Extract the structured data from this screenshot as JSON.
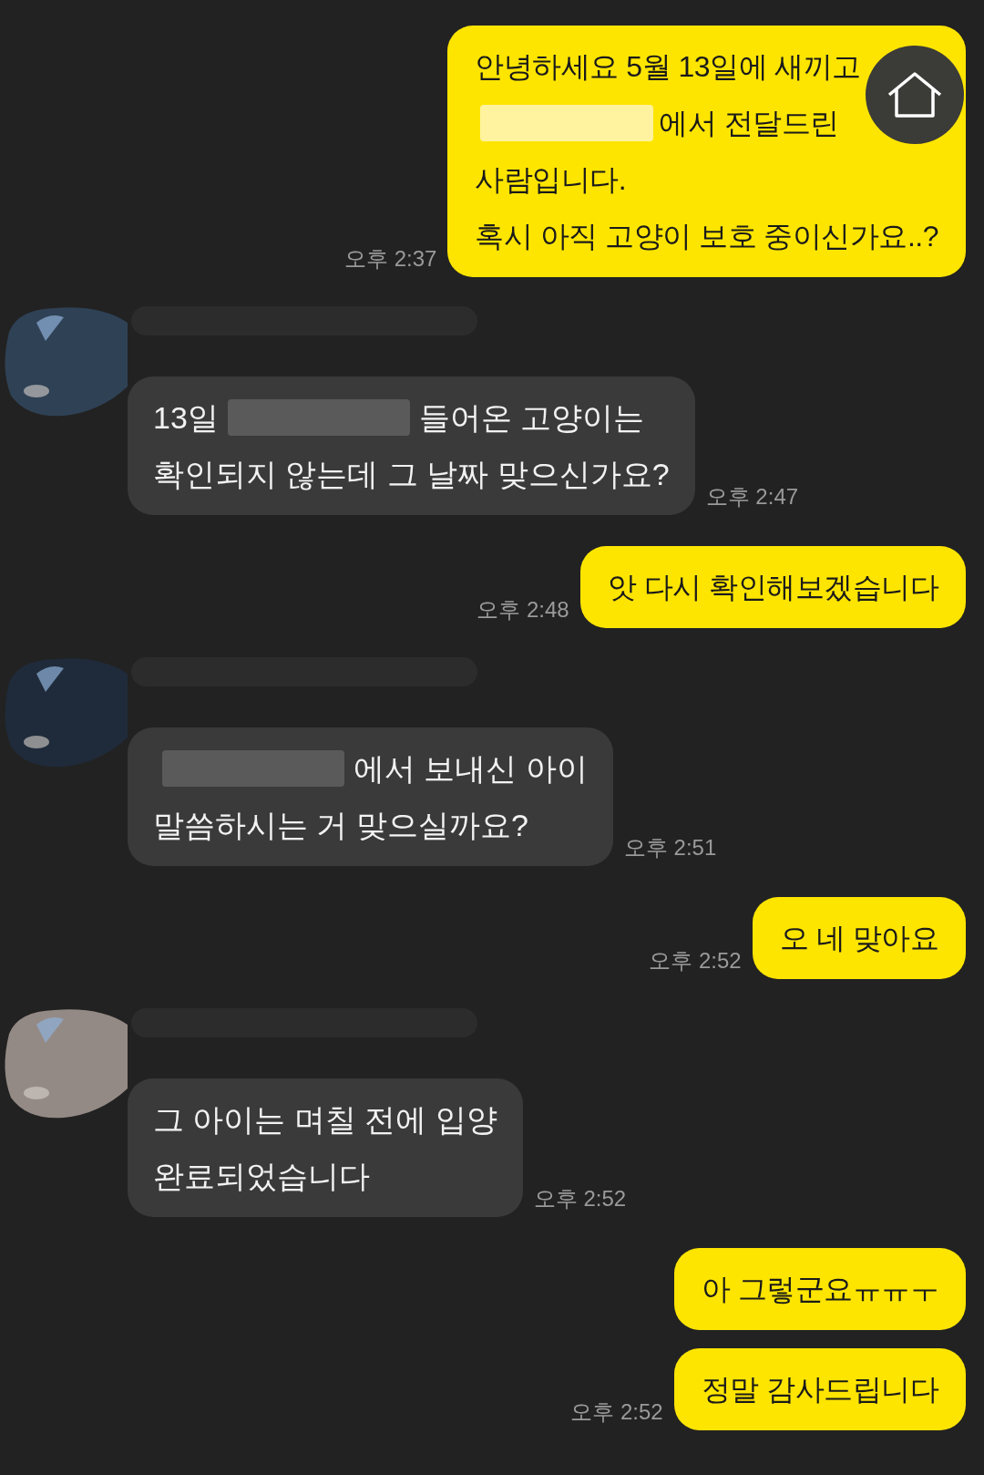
{
  "messages": [
    {
      "kind": "out",
      "lines": [
        [
          {
            "kind": "text",
            "text": "안녕하세요 5월 13일에 새끼고"
          }
        ],
        [
          {
            "kind": "redaction"
          },
          {
            "kind": "text",
            "text": "에서 전달드린"
          }
        ],
        [
          {
            "kind": "text",
            "text": "사람입니다."
          }
        ],
        [
          {
            "kind": "text",
            "text": "혹시 아직 고양이 보호 중이신가요..?"
          }
        ]
      ],
      "time": "오후 2:37"
    },
    {
      "kind": "in",
      "lines": [
        [
          {
            "kind": "text",
            "text": "13일"
          },
          {
            "kind": "redaction"
          },
          {
            "kind": "text",
            "text": "들어온 고양이는"
          }
        ],
        [
          {
            "kind": "text",
            "text": "확인되지 않는데 그 날짜 맞으신가요?"
          }
        ]
      ],
      "time": "오후 2:47"
    },
    {
      "kind": "out",
      "lines": [
        [
          {
            "kind": "text",
            "text": "앗 다시 확인해보겠습니다"
          }
        ]
      ],
      "time": "오후 2:48"
    },
    {
      "kind": "in",
      "lines": [
        [
          {
            "kind": "redaction"
          },
          {
            "kind": "text",
            "text": "에서 보내신 아이"
          }
        ],
        [
          {
            "kind": "text",
            "text": "말씀하시는 거 맞으실까요?"
          }
        ]
      ],
      "time": "오후 2:51"
    },
    {
      "kind": "out",
      "lines": [
        [
          {
            "kind": "text",
            "text": "오 네 맞아요"
          }
        ]
      ],
      "time": "오후 2:52"
    },
    {
      "kind": "in",
      "lines": [
        [
          {
            "kind": "text",
            "text": "그 아이는 며칠 전에 입양"
          }
        ],
        [
          {
            "kind": "text",
            "text": "완료되었습니다"
          }
        ]
      ],
      "time": "오후 2:52"
    },
    {
      "kind": "out",
      "lines": [
        [
          {
            "kind": "text",
            "text": "아 그렇군요ㅠㅠㅜ"
          }
        ]
      ]
    },
    {
      "kind": "out",
      "lines": [
        [
          {
            "kind": "text",
            "text": "정말 감사드립니다"
          }
        ]
      ],
      "time": "오후 2:52"
    }
  ]
}
